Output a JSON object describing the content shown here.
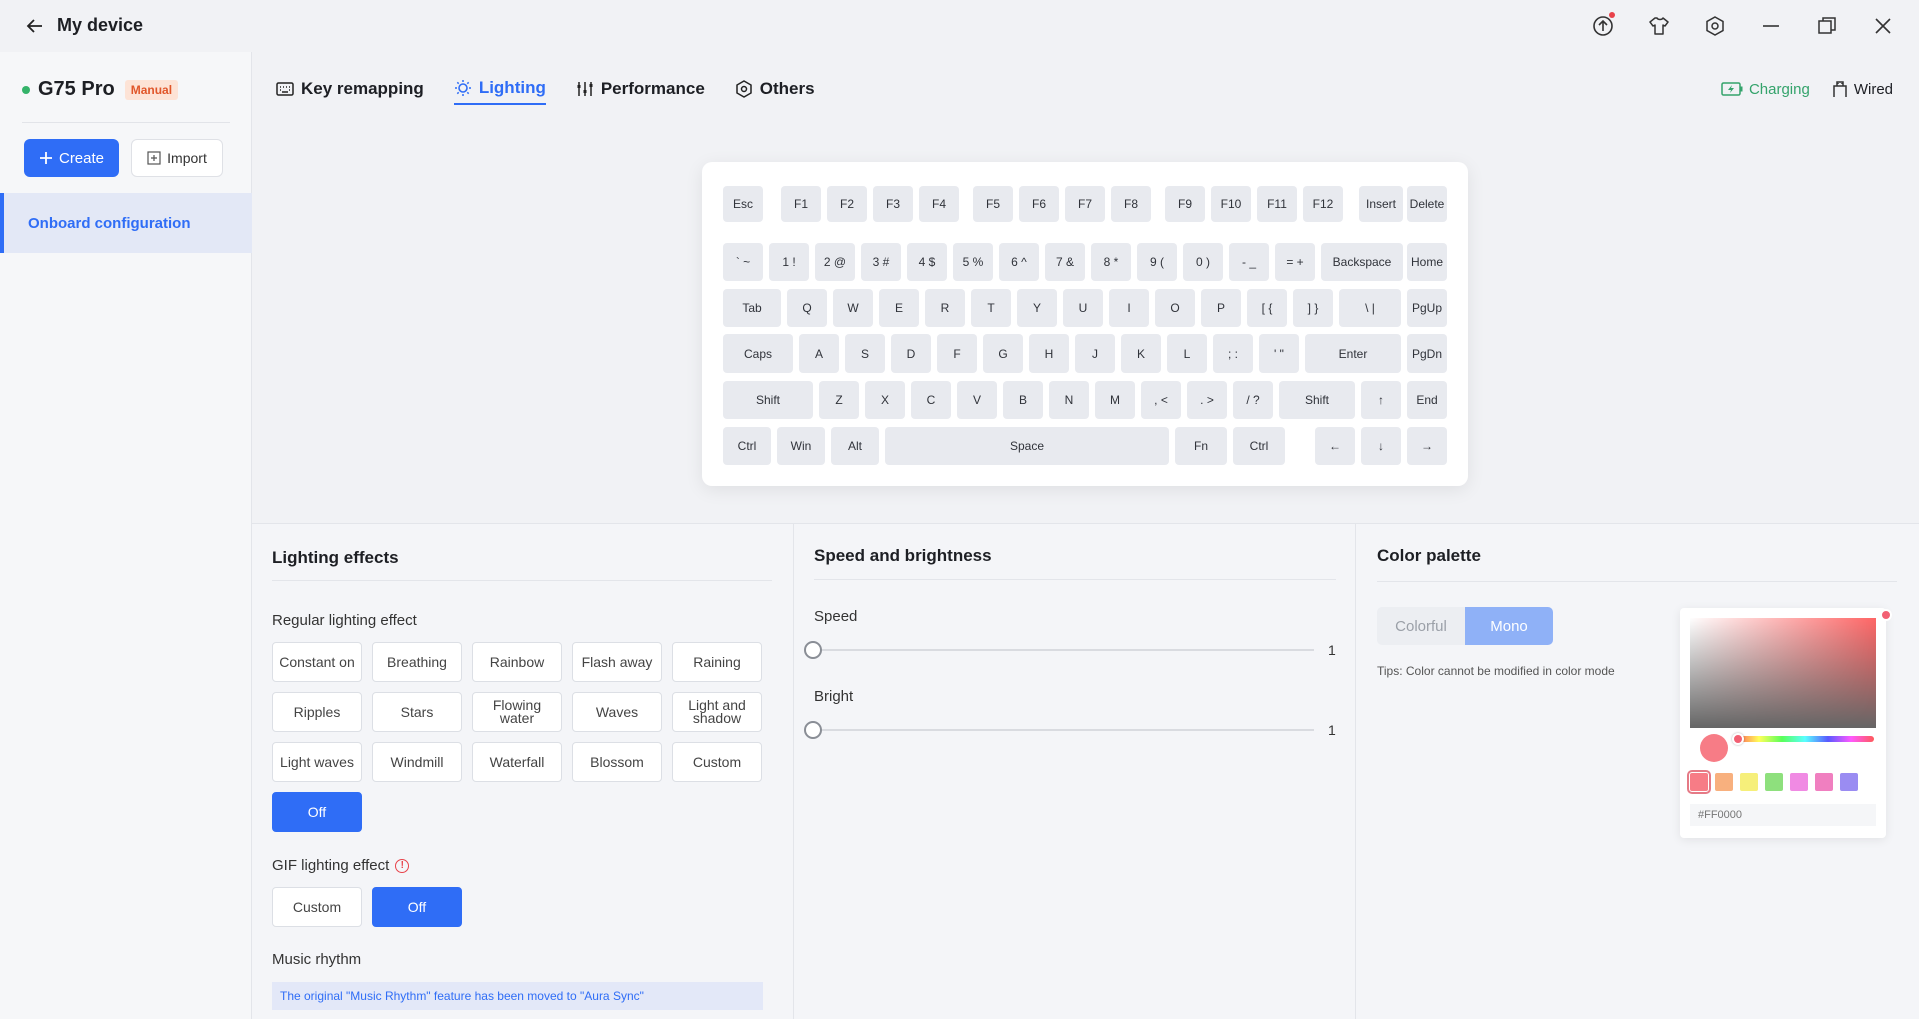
{
  "window": {
    "title": "My device",
    "controls": [
      "upload-icon",
      "shirt-icon",
      "settings-icon",
      "minimize-icon",
      "restore-icon",
      "close-icon"
    ]
  },
  "sidebar": {
    "device_name": "G75 Pro",
    "badge": "Manual",
    "create_label": "Create",
    "import_label": "Import",
    "nav_items": [
      {
        "label": "Onboard configuration"
      }
    ]
  },
  "tabs": [
    {
      "label": "Key remapping",
      "icon": "keyboard-icon"
    },
    {
      "label": "Lighting",
      "icon": "bulb-icon"
    },
    {
      "label": "Performance",
      "icon": "sliders-icon"
    },
    {
      "label": "Others",
      "icon": "hexagon-icon"
    }
  ],
  "active_tab": "Lighting",
  "connection": {
    "charging": "Charging",
    "wired": "Wired"
  },
  "keyboard": {
    "rows": [
      [
        "Esc",
        "F1",
        "F2",
        "F3",
        "F4",
        "F5",
        "F6",
        "F7",
        "F8",
        "F9",
        "F10",
        "F11",
        "F12",
        "Insert",
        "Delete"
      ],
      [
        "` ~",
        "1 !",
        "2 @",
        "3 #",
        "4 $",
        "5 %",
        "6 ^",
        "7 &",
        "8 *",
        "9 (",
        "0 )",
        "- _",
        "= +",
        "Backspace",
        "Home"
      ],
      [
        "Tab",
        "Q",
        "W",
        "E",
        "R",
        "T",
        "Y",
        "U",
        "I",
        "O",
        "P",
        "[ {",
        "] }",
        "\\ |",
        "PgUp"
      ],
      [
        "Caps",
        "A",
        "S",
        "D",
        "F",
        "G",
        "H",
        "J",
        "K",
        "L",
        "; :",
        "' \"",
        "Enter",
        "PgDn"
      ],
      [
        "Shift",
        "Z",
        "X",
        "C",
        "V",
        "B",
        "N",
        "M",
        ", <",
        ". >",
        "/ ?",
        "Shift",
        "↑",
        "End"
      ],
      [
        "Ctrl",
        "Win",
        "Alt",
        "Space",
        "Fn",
        "Ctrl",
        "←",
        "↓",
        "→"
      ]
    ]
  },
  "lighting_effects": {
    "title": "Lighting effects",
    "regular_label": "Regular lighting effect",
    "regular": [
      "Constant on",
      "Breathing",
      "Rainbow",
      "Flash away",
      "Raining",
      "Ripples",
      "Stars",
      "Flowing water",
      "Waves",
      "Light and shadow",
      "Light waves",
      "Windmill",
      "Waterfall",
      "Blossom",
      "Custom",
      "Off"
    ],
    "regular_active": "Off",
    "gif_label": "GIF lighting effect",
    "gif": [
      "Custom",
      "Off"
    ],
    "gif_active": "Off",
    "music_label": "Music rhythm",
    "music_notice": "The original \"Music Rhythm\" feature has been moved to \"Aura Sync\""
  },
  "speed_brightness": {
    "title": "Speed and brightness",
    "speed_label": "Speed",
    "speed_value": "1",
    "bright_label": "Bright",
    "bright_value": "1"
  },
  "color_palette": {
    "title": "Color palette",
    "modes": [
      "Colorful",
      "Mono"
    ],
    "active_mode": "Mono",
    "tips": "Tips:  Color cannot be modified in color mode",
    "current_color": "#f77c86",
    "hex_placeholder": "#FF0000",
    "swatches": [
      "#f77c86",
      "#f8b07e",
      "#f6ef7a",
      "#8ee07d",
      "#f08ae3",
      "#f07fc0",
      "#9a8cf2"
    ],
    "selected_swatch": 0
  },
  "colors": {
    "accent": "#2f6df6",
    "charging": "#34a36b",
    "status_online": "#34b36a"
  }
}
